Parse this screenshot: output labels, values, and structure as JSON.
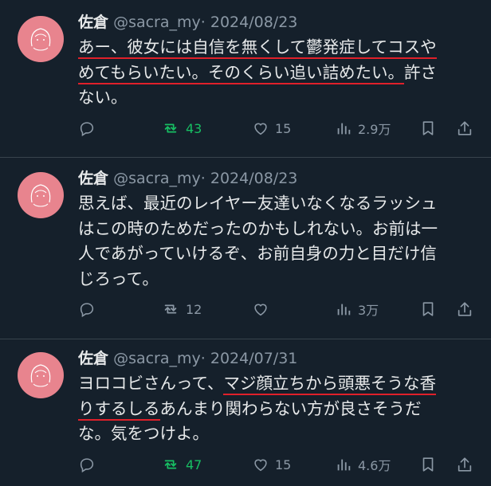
{
  "tweets": [
    {
      "name": "佐倉",
      "handle": "@sacra_my",
      "sep": "·",
      "date": "2024/08/23",
      "lines": [
        {
          "plain_before": "",
          "ul": "あー、彼女には自信を無くして鬱発症してコスや",
          "plain_after": ""
        },
        {
          "plain_before": "",
          "ul": "めてもらいたい。そのくらい追い詰めたい。",
          "plain_after": "許さ"
        },
        {
          "plain_before": "ない。",
          "ul": "",
          "plain_after": ""
        }
      ],
      "reply_count": "",
      "retweet_count": "43",
      "like_count": "15",
      "view_count": "2.9万",
      "retweeted": true
    },
    {
      "name": "佐倉",
      "handle": "@sacra_my",
      "sep": "·",
      "date": "2024/08/23",
      "lines": [
        {
          "plain_before": "思えば、最近のレイヤー友達いなくなるラッシュ",
          "ul": "",
          "plain_after": ""
        },
        {
          "plain_before": "はこの時のためだったのかもしれない。お前は一",
          "ul": "",
          "plain_after": ""
        },
        {
          "plain_before": "人であがっていけるぞ、お前自身の力と目だけ信",
          "ul": "",
          "plain_after": ""
        },
        {
          "plain_before": "じろって。",
          "ul": "",
          "plain_after": ""
        }
      ],
      "reply_count": "",
      "retweet_count": "12",
      "like_count": "",
      "view_count": "3万",
      "retweeted": false
    },
    {
      "name": "佐倉",
      "handle": "@sacra_my",
      "sep": "·",
      "date": "2024/07/31",
      "lines": [
        {
          "plain_before": "ヨロコビさんって、",
          "ul": "マジ顔立ちから頭悪そうな香",
          "plain_after": ""
        },
        {
          "plain_before": "",
          "ul": "りするしる",
          "plain_after": "あんまり関わらない方が良さそうだ"
        },
        {
          "plain_before": "な。気をつけよ。",
          "ul": "",
          "plain_after": ""
        }
      ],
      "reply_count": "",
      "retweet_count": "47",
      "like_count": "15",
      "view_count": "4.6万",
      "retweeted": true
    }
  ],
  "colors": {
    "background": "#15202b",
    "divider": "#38444d",
    "muted": "#8b98a5",
    "retweet_active": "#17bf63",
    "underline": "#e0202a",
    "avatar": "#e8848e"
  },
  "icons": [
    "reply-icon",
    "retweet-icon",
    "like-icon",
    "views-icon",
    "bookmark-icon",
    "share-icon"
  ]
}
